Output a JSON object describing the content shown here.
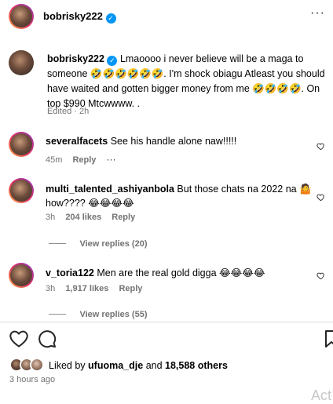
{
  "header": {
    "username": "bobrisky222",
    "more_icon": "more-horizontal-icon"
  },
  "caption": {
    "username": "bobrisky222",
    "text": "Lmaoooo i never believe will be a maga to someone 🤣🤣🤣🤣🤣🤣. I'm shock obiagu Atleast you should have waited and gotten bigger money from me 🤣🤣🤣🤣. On top $990 Mtcwwww. .",
    "meta": "Edited · 2h"
  },
  "comments": [
    {
      "username": "severalfacets",
      "text": "See his handle alone naw!!!!!",
      "time": "45m",
      "reply_label": "Reply",
      "more": "···"
    },
    {
      "username": "multi_talented_ashiyanbola",
      "text": "But those chats na 2022 na 🤷 how???? 😂😂😂😂",
      "time": "3h",
      "likes": "204 likes",
      "reply_label": "Reply",
      "view_replies": "View replies (20)"
    },
    {
      "username": "v_toria122",
      "text": "Men are the real gold digga 😂😂😂😂",
      "time": "3h",
      "likes": "1,917 likes",
      "reply_label": "Reply",
      "view_replies": "View replies (55)"
    }
  ],
  "actions": {
    "like_icon": "heart-icon",
    "comment_icon": "comment-icon",
    "save_icon": "bookmark-icon"
  },
  "likes_summary": {
    "prefix": "Liked by",
    "user": "ufuoma_dje",
    "middle": "and",
    "others": "18,588 others"
  },
  "timestamp": "3 hours ago",
  "watermark": "Act"
}
